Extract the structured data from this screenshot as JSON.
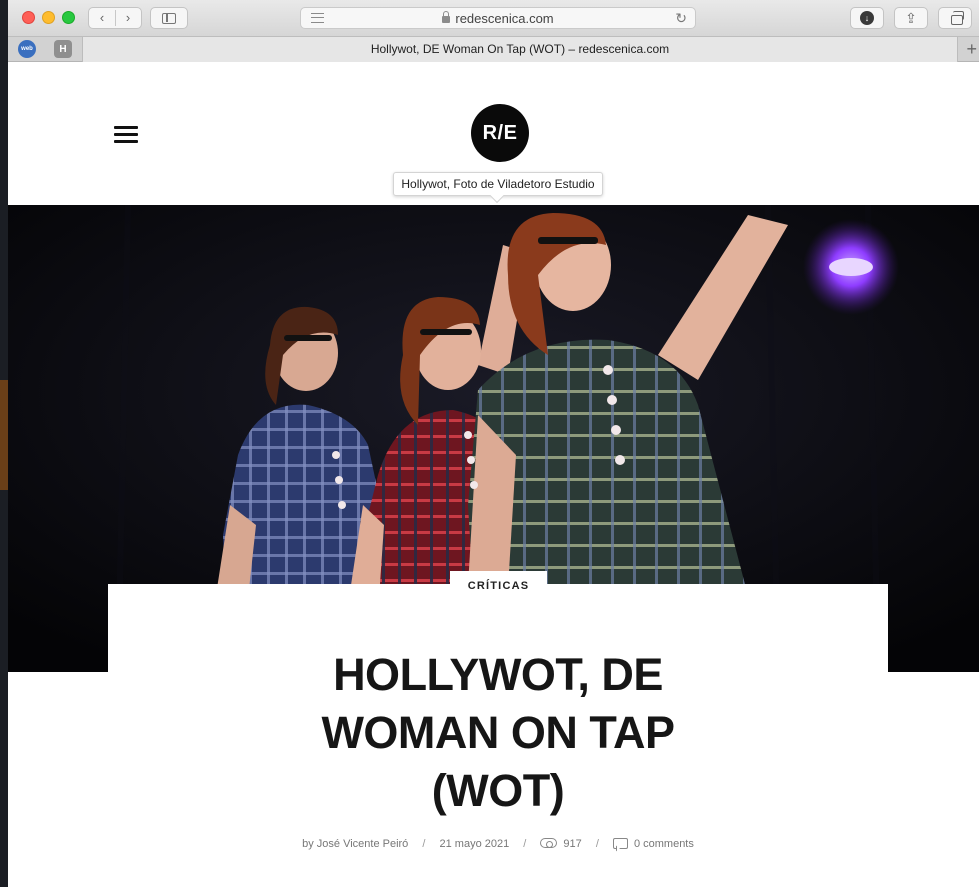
{
  "browser": {
    "url": "redescenica.com",
    "tab_title": "Hollywot, DE Woman On Tap (WOT) – redescenica.com",
    "pinned_tabs": [
      {
        "label": "web"
      },
      {
        "label": "H"
      }
    ],
    "icons": {
      "back": "chevron-left-icon",
      "forward": "chevron-right-icon",
      "sidebar": "sidebar-icon",
      "reader": "reader-icon",
      "lock": "lock-icon",
      "reload": "reload-icon",
      "download": "download-icon",
      "share": "share-icon",
      "tabs": "tabs-overview-icon",
      "new_tab": "plus-icon"
    }
  },
  "site": {
    "logo_text": "R/E",
    "menu_icon": "hamburger-icon",
    "hero_tooltip": "Hollywot, Foto de Viladetoro Estudio"
  },
  "article": {
    "category": "CRÍTICAS",
    "title_lines": [
      "HOLLYWOT, DE",
      "WOMAN ON TAP",
      "(WOT)"
    ],
    "meta": {
      "author": "by José Vicente Peiró",
      "date": "21 mayo 2021",
      "views": "917",
      "comments": "0 comments",
      "separator": "/"
    }
  },
  "colors": {
    "traffic_red": "#fe5f57",
    "traffic_yellow": "#febc2e",
    "traffic_green": "#28c840",
    "hero_background": "#06060a",
    "stage_light": "#8e3cff",
    "title_text": "#161616"
  }
}
